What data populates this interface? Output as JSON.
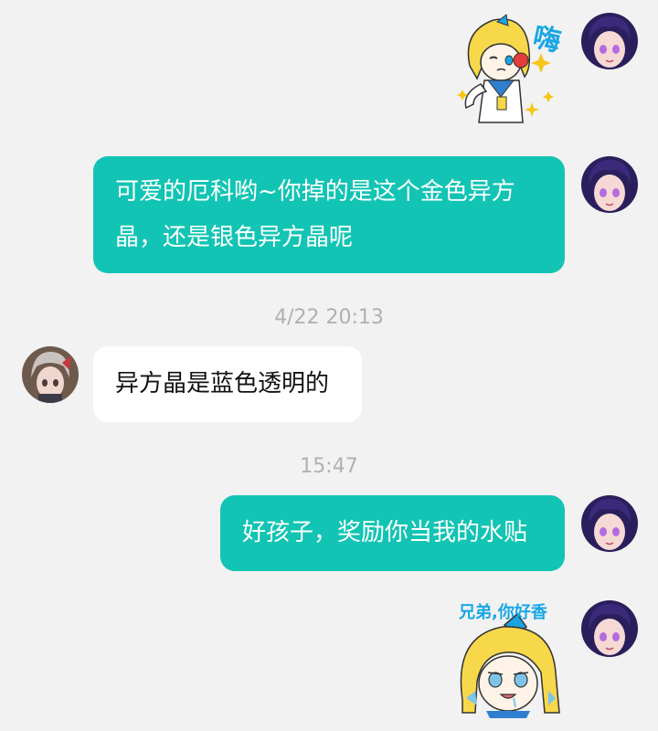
{
  "colors": {
    "outgoing_bubble": "#12c4b3",
    "incoming_bubble": "#ffffff",
    "background": "#f2f2f2",
    "timestamp": "#b0b0b0"
  },
  "messages": [
    {
      "type": "sticker",
      "direction": "out",
      "caption": "嗨",
      "icon": "waving-girl-sticker-icon"
    },
    {
      "type": "text",
      "direction": "out",
      "lines": [
        "可爱的厄科哟~你掉的是这个金色异方",
        "晶，还是银色异方晶呢"
      ]
    },
    {
      "type": "timestamp",
      "text": "4/22  20:13"
    },
    {
      "type": "text",
      "direction": "in",
      "text": "异方晶是蓝色透明的"
    },
    {
      "type": "timestamp",
      "text": "15:47"
    },
    {
      "type": "text",
      "direction": "out",
      "text": "好孩子，奖励你当我的水贴"
    },
    {
      "type": "sticker",
      "direction": "out",
      "caption": "兄弟,你好香",
      "icon": "drooling-girl-sticker-icon"
    }
  ]
}
